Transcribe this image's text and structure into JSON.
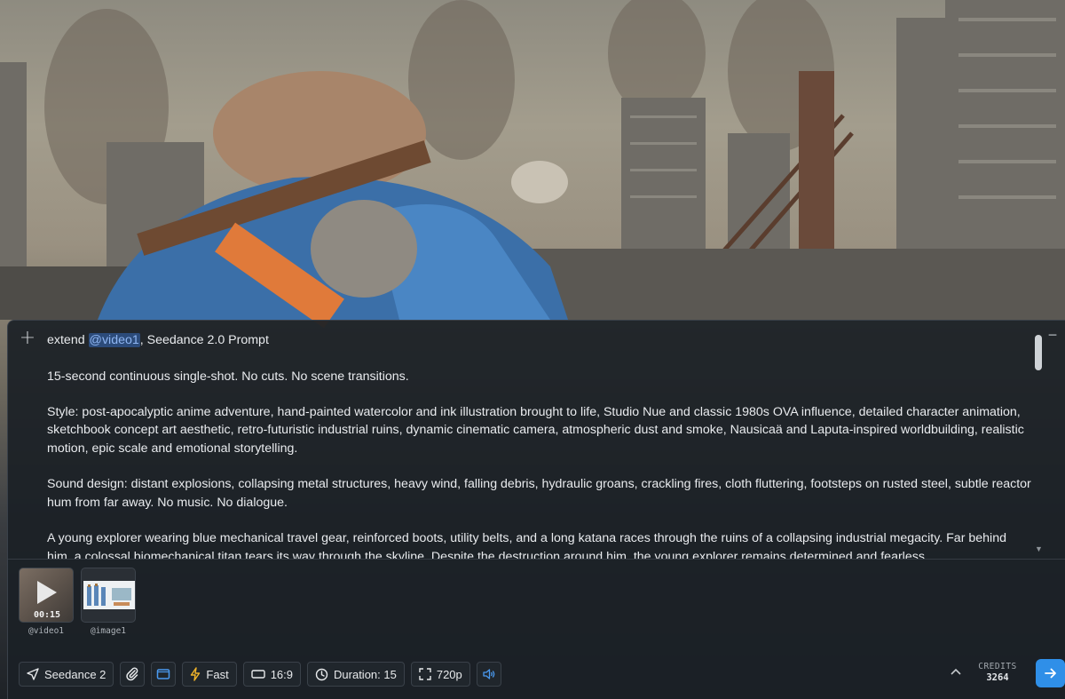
{
  "prompt": {
    "line1_prefix": "extend ",
    "mention": "@video1",
    "line1_suffix": ", Seedance 2.0 Prompt",
    "paragraphs": [
      "15-second continuous single-shot. No cuts. No scene transitions.",
      "Style: post-apocalyptic anime adventure, hand-painted watercolor and ink illustration brought to life, Studio Nue and classic 1980s OVA influence, detailed character animation, sketchbook concept art aesthetic, retro-futuristic industrial ruins, dynamic cinematic camera, atmospheric dust and smoke, Nausicaä and Laputa-inspired worldbuilding, realistic motion, epic scale and emotional storytelling.",
      "Sound design: distant explosions, collapsing metal structures, heavy wind, falling debris, hydraulic groans, crackling fires, cloth fluttering, footsteps on rusted steel, subtle reactor hum from far away. No music. No dialogue.",
      "A young explorer wearing blue mechanical travel gear, reinforced boots, utility belts, and a long katana races through the ruins of a collapsing industrial megacity. Far behind him, a colossal biomechanical titan tears its way through the skyline. Despite the destruction around him, the young explorer remains determined and fearless."
    ]
  },
  "attachments": [
    {
      "label": "@video1",
      "duration": "00:15",
      "kind": "video"
    },
    {
      "label": "@image1",
      "kind": "image"
    }
  ],
  "toolbar": {
    "model": "Seedance 2",
    "speed": "Fast",
    "aspect": "16:9",
    "duration": "Duration: 15",
    "resolution": "720p"
  },
  "credits": {
    "label": "CREDITS",
    "value": "3264"
  },
  "colors": {
    "accent": "#2f8fe8",
    "mention_bg": "#2c4b7a",
    "panel_bg": "#1b2026"
  }
}
